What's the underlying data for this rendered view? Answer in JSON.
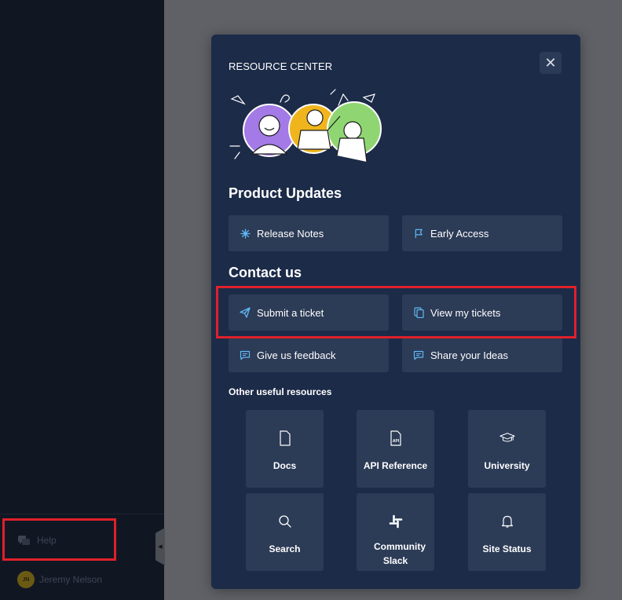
{
  "sidebar": {
    "help_label": "Help",
    "user_initials": "JN",
    "user_name": "Jeremy Nelson"
  },
  "panel": {
    "title": "RESOURCE CENTER",
    "close_glyph": "✕",
    "product_updates": {
      "heading": "Product Updates",
      "items": [
        {
          "label": "Release Notes",
          "icon": "sparkle-icon"
        },
        {
          "label": "Early Access",
          "icon": "flag-icon"
        }
      ]
    },
    "contact": {
      "heading": "Contact us",
      "items": [
        {
          "label": "Submit a ticket",
          "icon": "paper-plane-icon"
        },
        {
          "label": "View my tickets",
          "icon": "copy-icon"
        },
        {
          "label": "Give us feedback",
          "icon": "chat-bubble-icon"
        },
        {
          "label": "Share your Ideas",
          "icon": "chat-bubble-icon"
        }
      ]
    },
    "resources": {
      "heading": "Other useful resources",
      "tiles": [
        {
          "label": "Docs",
          "icon": "document-icon"
        },
        {
          "label": "API Reference",
          "icon": "api-file-icon",
          "icon_text": "API"
        },
        {
          "label": "University",
          "icon": "graduation-cap-icon"
        },
        {
          "label": "Search",
          "icon": "search-icon"
        },
        {
          "label": "Community Slack",
          "icon": "slack-icon"
        },
        {
          "label": "Site Status",
          "icon": "bell-icon"
        }
      ]
    }
  },
  "colors": {
    "page_overlay": "#5f6166",
    "sidebar_bg": "#111722",
    "panel_bg": "#1c2b48",
    "card_bg": "#2c3b56",
    "icon_accent": "#5fb8f5",
    "annotation": "#e0202a"
  }
}
